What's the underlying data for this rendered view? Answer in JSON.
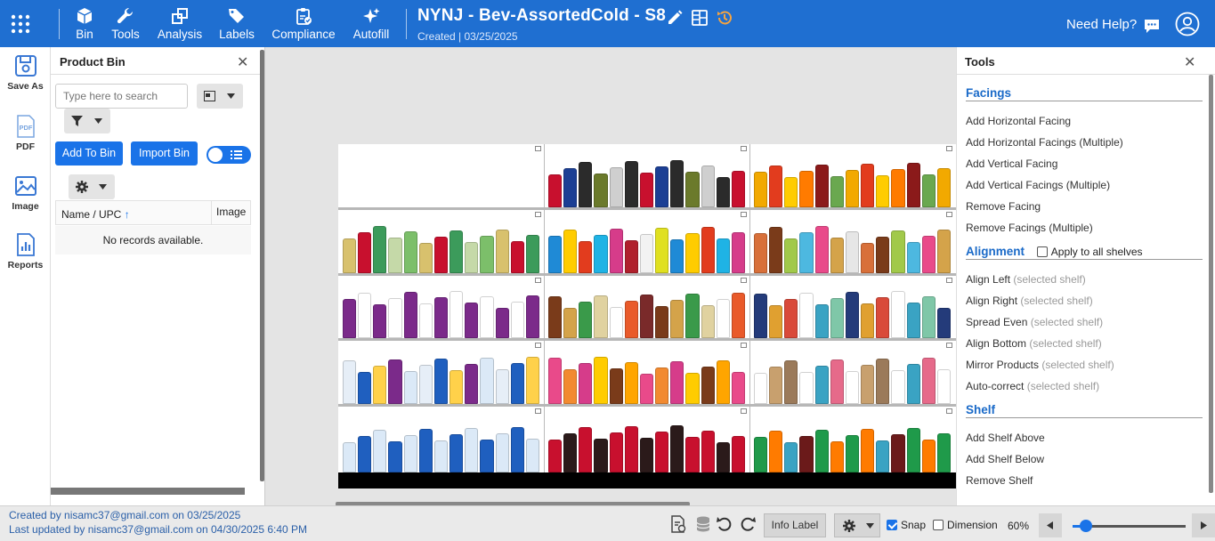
{
  "topbar": {
    "menu": [
      {
        "label": "Bin",
        "icon": "cube-icon"
      },
      {
        "label": "Tools",
        "icon": "wrench-icon"
      },
      {
        "label": "Analysis",
        "icon": "analysis-icon"
      },
      {
        "label": "Labels",
        "icon": "tags-icon"
      },
      {
        "label": "Compliance",
        "icon": "clipboard-check-icon"
      },
      {
        "label": "Autofill",
        "icon": "sparkle-icon"
      }
    ],
    "title": "NYNJ - Bev-AssortedCold - S8",
    "subtitle": "Created | 03/25/2025",
    "help_label": "Need Help?"
  },
  "leftnav": [
    {
      "label": "Save As",
      "icon": "save-as-icon"
    },
    {
      "label": "PDF",
      "icon": "pdf-icon"
    },
    {
      "label": "Image",
      "icon": "image-icon"
    },
    {
      "label": "Reports",
      "icon": "reports-icon"
    }
  ],
  "bin": {
    "title": "Product Bin",
    "search_placeholder": "Type here to search",
    "add_to_bin": "Add To Bin",
    "import_bin": "Import Bin",
    "col_name": "Name / UPC",
    "col_image": "Image",
    "empty": "No records available."
  },
  "tools": {
    "title": "Tools",
    "facings_header": "Facings",
    "facings": [
      "Add Horizontal Facing",
      "Add Horizontal Facings (Multiple)",
      "Add Vertical Facing",
      "Add Vertical Facings (Multiple)",
      "Remove Facing",
      "Remove Facings (Multiple)"
    ],
    "alignment_header": "Alignment",
    "apply_all": "Apply to all shelves",
    "alignment": [
      {
        "label": "Align Left",
        "note": "(selected shelf)"
      },
      {
        "label": "Align Right",
        "note": "(selected shelf)"
      },
      {
        "label": "Spread Even",
        "note": "(selected shelf)"
      },
      {
        "label": "Align Bottom",
        "note": "(selected shelf)"
      },
      {
        "label": "Mirror Products",
        "note": "(selected shelf)"
      },
      {
        "label": "Auto-correct",
        "note": "(selected shelf)"
      }
    ],
    "shelf_header": "Shelf",
    "shelf": [
      "Add Shelf Above",
      "Add Shelf Below",
      "Remove Shelf"
    ]
  },
  "status": {
    "created": "Created by nisamc37@gmail.com on 03/25/2025",
    "updated": "Last updated by nisamc37@gmail.com on 04/30/2025 6:40 PM",
    "info_label": "Info Label",
    "snap_label": "Snap",
    "snap_checked": true,
    "dimension_label": "Dimension",
    "dimension_checked": false,
    "zoom": "60%",
    "zoom_fraction": 0.12
  },
  "colors": {
    "topbar": "#1f6fd1",
    "accent": "#1a73e8",
    "section": "#1a6ac8"
  },
  "planogram": {
    "shelves": [
      [
        "",
        "#c8102e|#1c3f94|#2b2b2b|#6b7a2b|#cfcfcf|#2b2b2b",
        "#f2a900|#e23c1e|#ffcc00|#ff7b00|#8b1a1a|#6aa84f"
      ],
      [
        "#d8c16d|#c8102e|#3c9b5b|#c5d9a8|#7cbf6a",
        "#1f8ad6|#ffcc00|#e23c1e|#1fb3e5|#d63c8a|#b0202c|#f2f2f2|#e0e020",
        "#d8703a|#7a3b1a|#a1c94a|#4db8e0|#e94a8a|#d4a34a|#e6e6e6"
      ],
      [
        "#7b2a8a|#ffffff",
        "#7a3b1a|#d4a34a|#3a9a4a|#e0d2a0|#ffffff|#e95a2a|#7a2a2a",
        "#243b7a|#e0a030|#d94a3a|#ffffff|#3aa3c3|#7fc7a8"
      ],
      [
        "#e6eef7|#1f5fbf|#ffd14a|#7b2a8a|#dbe9f7",
        "#e94a8a|#f28a30|#d63c8a|#ffcc00|#7a3b1a|#ffa500",
        "#ffffff|#c8a06e|#9b7a5a|#ffffff|#3aa3c3|#e66a8a"
      ],
      [
        "#dbe9f7|#1f5fbf",
        "#c8102e|#2b1a1a|#c8102e|#2b1a1a|#c8102e",
        "#1f9a4a|#ff7b00|#3aa3c3|#6b1a1a|#1f9a4a|#ff7b00"
      ]
    ]
  }
}
